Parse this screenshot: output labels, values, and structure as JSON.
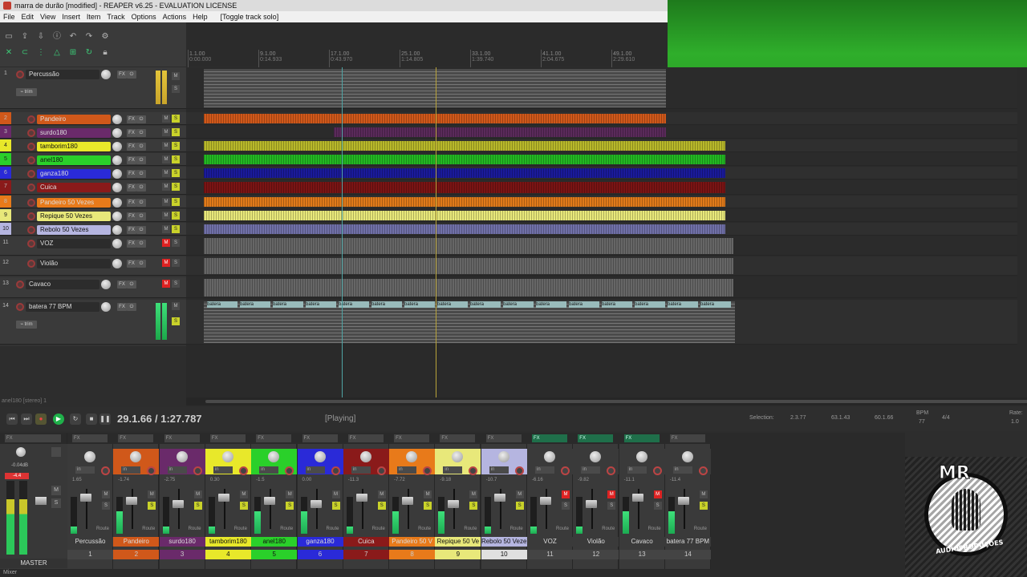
{
  "window": {
    "title": "marra de durão [modified] - REAPER v6.25 - EVALUATION LICENSE"
  },
  "menu": [
    "File",
    "Edit",
    "View",
    "Insert",
    "Item",
    "Track",
    "Options",
    "Actions",
    "Help",
    "[Toggle track solo]"
  ],
  "ruler": [
    {
      "bar": "1.1.00",
      "time": "0:00.000"
    },
    {
      "bar": "9.1.00",
      "time": "0:14.933"
    },
    {
      "bar": "17.1.00",
      "time": "0:43.970"
    },
    {
      "bar": "25.1.00",
      "time": "1:14.805"
    },
    {
      "bar": "33.1.00",
      "time": "1:39.740"
    },
    {
      "bar": "41.1.00",
      "time": "2:04.675"
    },
    {
      "bar": "49.1.00",
      "time": "2:29.610"
    }
  ],
  "tracks": [
    {
      "num": "1",
      "name": "Percussão",
      "color": "#3a3a3a",
      "folder": true
    },
    {
      "num": "2",
      "name": "Pandeiro",
      "color": "#d0581a"
    },
    {
      "num": "3",
      "name": "surdo180",
      "color": "#6a2a6a"
    },
    {
      "num": "4",
      "name": "tamborim180",
      "color": "#e8e82a"
    },
    {
      "num": "5",
      "name": "anel180",
      "color": "#2ad02a"
    },
    {
      "num": "6",
      "name": "ganza180",
      "color": "#2a2ad8"
    },
    {
      "num": "7",
      "name": "Cuica",
      "color": "#8a1a1a"
    },
    {
      "num": "8",
      "name": "Pandeiro 50 Vezes",
      "color": "#e87a1a"
    },
    {
      "num": "9",
      "name": "Repique 50 Vezes",
      "color": "#e8e87a"
    },
    {
      "num": "10",
      "name": "Rebolo 50 Vezes",
      "color": "#b5b5e0"
    },
    {
      "num": "11",
      "name": "VOZ",
      "color": "#3a3a3a"
    },
    {
      "num": "12",
      "name": "Violão",
      "color": "#3a3a3a"
    },
    {
      "num": "13",
      "name": "Cavaco",
      "color": "#3a3a3a"
    },
    {
      "num": "14",
      "name": "batera 77 BPM",
      "color": "#3a3a3a"
    }
  ],
  "clip_label": "batera",
  "status_left": "anel180 [stereo] 1",
  "transport": {
    "position": "29.1.66 / 1:27.787",
    "state": "[Playing]",
    "selection_label": "Selection:",
    "sel_start": "2.3.77",
    "sel_end": "63.1.43",
    "sel_len": "60.1.66",
    "bpm_label": "BPM",
    "bpm": "77",
    "timesig": "4/4",
    "rate_label": "Rate:",
    "rate": "1.0"
  },
  "mixer": {
    "master_label": "MASTER",
    "master_db": "-0.04dB",
    "mixer_tab": "Mixer",
    "fx_label": "FX",
    "in_label": "in",
    "route_label": "Route",
    "strips": [
      {
        "name": "Percussão",
        "num": "1",
        "color": "#3a3a3a",
        "numcolor": "#444",
        "vol": "1.65",
        "fx": false
      },
      {
        "name": "Pandeiro",
        "num": "2",
        "color": "#d0581a",
        "numcolor": "#d0581a",
        "vol": "-1.74",
        "fx": false
      },
      {
        "name": "surdo180",
        "num": "3",
        "color": "#6a2a6a",
        "numcolor": "#6a2a6a",
        "vol": "-2.75",
        "fx": false
      },
      {
        "name": "tamborim180",
        "num": "4",
        "color": "#e8e82a",
        "numcolor": "#e8e82a",
        "vol": "0.30",
        "fx": false
      },
      {
        "name": "anel180",
        "num": "5",
        "color": "#2ad02a",
        "numcolor": "#2ad02a",
        "vol": "-1.5",
        "fx": false
      },
      {
        "name": "ganza180",
        "num": "6",
        "color": "#2a2ad8",
        "numcolor": "#2a2ad8",
        "vol": "0.00",
        "fx": false
      },
      {
        "name": "Cuica",
        "num": "7",
        "color": "#8a1a1a",
        "numcolor": "#8a1a1a",
        "vol": "-11.3",
        "fx": false
      },
      {
        "name": "Pandeiro 50 V",
        "num": "8",
        "color": "#e87a1a",
        "numcolor": "#e87a1a",
        "vol": "-7.72",
        "fx": false
      },
      {
        "name": "Repique 50 Ve",
        "num": "9",
        "color": "#e8e87a",
        "numcolor": "#e8e87a",
        "vol": "-9.18",
        "fx": false
      },
      {
        "name": "Rebolo 50 Veze",
        "num": "10",
        "color": "#b5b5e0",
        "numcolor": "#e0e0e0",
        "vol": "-10.7",
        "fx": false
      },
      {
        "name": "VOZ",
        "num": "11",
        "color": "#3a3a3a",
        "numcolor": "#444",
        "vol": "-6.16",
        "fx": true
      },
      {
        "name": "Violão",
        "num": "12",
        "color": "#3a3a3a",
        "numcolor": "#444",
        "vol": "-9.82",
        "fx": true
      },
      {
        "name": "Cavaco",
        "num": "13",
        "color": "#3a3a3a",
        "numcolor": "#444",
        "vol": "-11.1",
        "fx": true
      },
      {
        "name": "batera 77 BPM",
        "num": "14",
        "color": "#3a3a3a",
        "numcolor": "#444",
        "vol": "-11.4",
        "fx": false
      }
    ]
  },
  "logo": {
    "top_text": "MR",
    "bottom_text": "AUDIOPRODUÇÕES"
  }
}
